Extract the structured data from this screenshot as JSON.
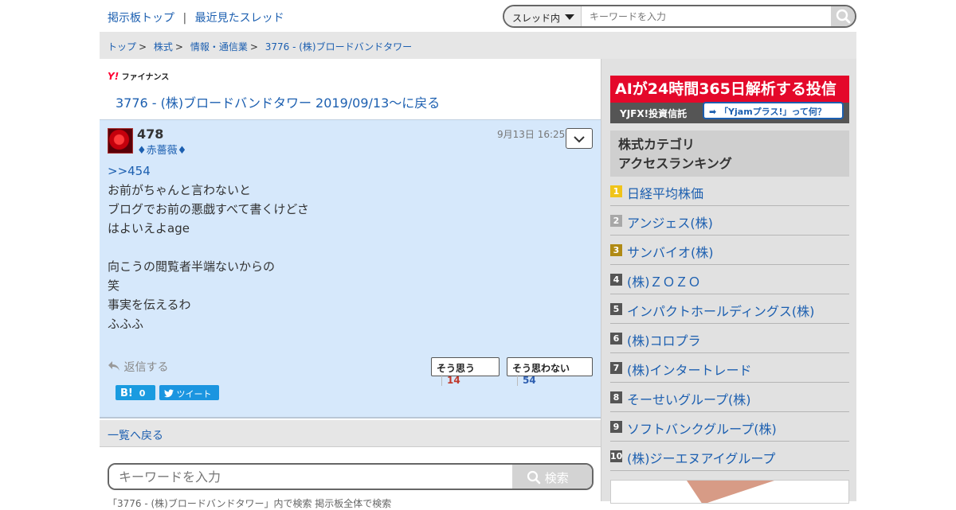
{
  "top": {
    "link_top": "掲示板トップ",
    "separator": "|",
    "link_recent": "最近見たスレッド",
    "search_scope": "スレッド内",
    "search_placeholder": "キーワードを入力"
  },
  "breadcrumb": [
    "トップ",
    "株式",
    "情報・通信業",
    "3776 - (株)ブロードバンドタワー"
  ],
  "breadcrumb_sep": ">",
  "brand": {
    "y": "Y!",
    "name": "ファイナンス"
  },
  "back_link": "3776 - (株)ブロードバンドタワー 2019/09/13〜に戻る",
  "post": {
    "number": "478",
    "author": "♦赤薔薇♦",
    "time": "9月13日 16:25",
    "menu_icon": "chevron-down",
    "body": [
      "&gt;&gt;454",
      "お前がちゃんと言わないと",
      "ブログでお前の悪戯すべて書くけどさ",
      "はよいえよage",
      "",
      "向こうの閲覧者半端ないからの",
      "笑",
      "事実を伝えるわ",
      "ふふふ"
    ],
    "reply_label": "返信する",
    "agree_label": "そう思う",
    "agree_count": "14",
    "disagree_label": "そう思わない",
    "disagree_count": "54",
    "hatena_label": "B!",
    "hatena_count": "0",
    "tweet_label": "ツイート"
  },
  "list_back": "一覧へ戻る",
  "bottom_search": {
    "placeholder": "キーワードを入力",
    "button": "検索"
  },
  "radios_text": "「3776 - (株)ブロードバンドタワー」内で検索   掲示板全体で検索",
  "ad": {
    "headline": "AIが24時間365日解析する投信",
    "brand": "YJFX!投資信託",
    "cta": "「Yjamプラス!」って何？"
  },
  "ranking": {
    "title_line1": "株式カテゴリ",
    "title_line2": "アクセスランキング",
    "items": [
      {
        "rank": "1",
        "name": "日経平均株価"
      },
      {
        "rank": "2",
        "name": "アンジェス(株)"
      },
      {
        "rank": "3",
        "name": "サンバイオ(株)"
      },
      {
        "rank": "4",
        "name": "(株)ＺＯＺＯ"
      },
      {
        "rank": "5",
        "name": "インパクトホールディングス(株)"
      },
      {
        "rank": "6",
        "name": "(株)コロプラ"
      },
      {
        "rank": "7",
        "name": "(株)インタートレード"
      },
      {
        "rank": "8",
        "name": "そーせいグループ(株)"
      },
      {
        "rank": "9",
        "name": "ソフトバンクグループ(株)"
      },
      {
        "rank": "10",
        "name": "(株)ジーエヌアイグループ"
      }
    ],
    "badge_colors": [
      "#f0c419",
      "#a8a8a8",
      "#b08a14",
      "#555555",
      "#555555",
      "#555555",
      "#555555",
      "#555555",
      "#555555",
      "#555555"
    ]
  }
}
